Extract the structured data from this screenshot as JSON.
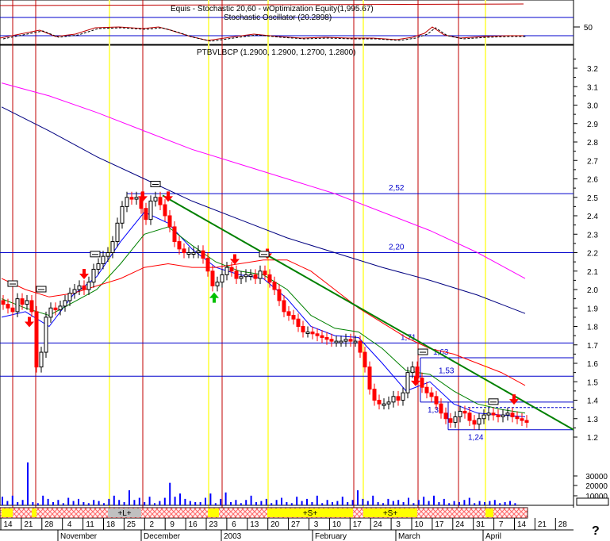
{
  "header": {
    "indicator_title": "Equis - Stochastic 20,60 - wOptimization Equity(1,995.67)",
    "oscillator_title": "Stochastic Oscillator (20.2898)",
    "oscillator_level_label": "50",
    "price_title": "PTBVLBCP (1.2900, 1.2900, 1.2700, 1.2800)",
    "help_glyph": "?"
  },
  "colors": {
    "up_candle": "#ffffff",
    "down_candle": "#ff0000",
    "ma_fast": "#0000ff",
    "ma_mid": "#008000",
    "ma_red": "#ff0000",
    "ma_magenta": "#ff00ff",
    "ma_navy": "#000080",
    "trendline": "#008000",
    "signal_up": "#00c000",
    "signal_down": "#ff0000",
    "vertical_red": "#c00000",
    "vertical_yellow": "#ffff66",
    "level_line": "#0000cc",
    "volume": "#0000ff"
  },
  "chart_data": {
    "type": "line",
    "title": "PTBVLBCP (1.2900, 1.2900, 1.2700, 1.2800)",
    "ylim": [
      1.15,
      3.3
    ],
    "y_ticks": [
      "3.2",
      "3.1",
      "3.0",
      "2.9",
      "2.8",
      "2.7",
      "2.6",
      "2.5",
      "2.4",
      "2.3",
      "2.2",
      "2.1",
      "2.0",
      "1.9",
      "1.8",
      "1.7",
      "1.6",
      "1.5",
      "1.4",
      "1.3",
      "1.2"
    ],
    "x_day_ticks": [
      "14",
      "21",
      "28",
      "4",
      "11",
      "18",
      "25",
      "2",
      "9",
      "16",
      "23",
      "6",
      "13",
      "20",
      "27",
      "3",
      "10",
      "17",
      "24",
      "3",
      "10",
      "17",
      "24",
      "31",
      "7",
      "14",
      "21",
      "28"
    ],
    "x_month_labels": [
      "November",
      "December",
      "2003",
      "February",
      "March",
      "April"
    ],
    "fib_levels": [
      {
        "label": "2,52",
        "value": 2.52
      },
      {
        "label": "2,20",
        "value": 2.2
      },
      {
        "label": "1,71",
        "value": 1.71
      },
      {
        "label": "1,63",
        "value": 1.63
      },
      {
        "label": "1,53",
        "value": 1.53
      },
      {
        "label": "1,39",
        "value": 1.39
      },
      {
        "label": "1,24",
        "value": 1.24
      }
    ],
    "series": [
      {
        "name": "PTBVLBCP close",
        "x": [
          0,
          6,
          12,
          18,
          24,
          30,
          36,
          42,
          48,
          54,
          60,
          66,
          72,
          78,
          84,
          90,
          96,
          102,
          108,
          114,
          120,
          126,
          132,
          138,
          144,
          150,
          156,
          162,
          168,
          174,
          180,
          186,
          192,
          198,
          204,
          210,
          216,
          222,
          228,
          234,
          240,
          246,
          252,
          258,
          264,
          270,
          276,
          282,
          288,
          294,
          300,
          306,
          312,
          318,
          324,
          330,
          336,
          342,
          348,
          354,
          360,
          366,
          372,
          378,
          384,
          390,
          396,
          402,
          408,
          414,
          420,
          426,
          432,
          438,
          444,
          450,
          456,
          462,
          468,
          474,
          480,
          486,
          492,
          498,
          504,
          510,
          516,
          522,
          528,
          534,
          540,
          546,
          552,
          558,
          564,
          570,
          576,
          582,
          588,
          594,
          600,
          606,
          612,
          618,
          624,
          630,
          636,
          642,
          648,
          654,
          660
        ],
        "values": [
          1.92,
          1.9,
          1.88,
          1.95,
          1.92,
          1.94,
          1.88,
          1.58,
          1.66,
          1.85,
          1.9,
          1.89,
          1.91,
          1.94,
          1.98,
          2.0,
          2.02,
          2.0,
          2.04,
          2.11,
          2.14,
          2.18,
          2.2,
          2.26,
          2.36,
          2.45,
          2.5,
          2.49,
          2.5,
          2.44,
          2.38,
          2.48,
          2.5,
          2.46,
          2.4,
          2.34,
          2.26,
          2.22,
          2.2,
          2.2,
          2.2,
          2.21,
          2.17,
          2.1,
          2.02,
          2.04,
          2.08,
          2.12,
          2.1,
          2.06,
          2.07,
          2.08,
          2.08,
          2.06,
          2.1,
          2.08,
          2.04,
          2.0,
          1.94,
          1.88,
          1.86,
          1.84,
          1.8,
          1.77,
          1.77,
          1.76,
          1.75,
          1.74,
          1.73,
          1.72,
          1.72,
          1.72,
          1.73,
          1.72,
          1.72,
          1.66,
          1.58,
          1.46,
          1.4,
          1.38,
          1.38,
          1.39,
          1.42,
          1.4,
          1.44,
          1.55,
          1.58,
          1.52,
          1.47,
          1.44,
          1.42,
          1.38,
          1.33,
          1.3,
          1.28,
          1.31,
          1.34,
          1.33,
          1.29,
          1.27,
          1.3,
          1.32,
          1.33,
          1.32,
          1.31,
          1.32,
          1.33,
          1.31,
          1.3,
          1.29,
          1.28
        ]
      },
      {
        "name": "Moving average (short)",
        "x": [
          0,
          30,
          60,
          90,
          120,
          150,
          180,
          210,
          240,
          270,
          300,
          330,
          360,
          390,
          420,
          450,
          480,
          510,
          540,
          570,
          600,
          630,
          660
        ],
        "values": [
          1.85,
          1.88,
          1.8,
          1.97,
          2.07,
          2.26,
          2.42,
          2.36,
          2.22,
          2.12,
          2.08,
          2.06,
          1.95,
          1.8,
          1.75,
          1.74,
          1.6,
          1.45,
          1.5,
          1.38,
          1.33,
          1.32,
          1.31
        ]
      },
      {
        "name": "Moving average (medium)",
        "x": [
          0,
          30,
          60,
          90,
          120,
          150,
          180,
          210,
          240,
          270,
          300,
          330,
          360,
          390,
          420,
          450,
          480,
          510,
          540,
          570,
          600,
          630,
          660
        ],
        "values": [
          1.95,
          1.9,
          1.86,
          1.93,
          2.0,
          2.14,
          2.3,
          2.34,
          2.24,
          2.15,
          2.1,
          2.08,
          2.0,
          1.86,
          1.79,
          1.77,
          1.68,
          1.56,
          1.54,
          1.45,
          1.38,
          1.35,
          1.33
        ]
      },
      {
        "name": "Moving average (long, red)",
        "x": [
          0,
          30,
          60,
          90,
          120,
          150,
          180,
          210,
          240,
          270,
          300,
          330,
          360,
          390,
          420,
          450,
          480,
          510,
          540,
          570,
          600,
          630,
          660
        ],
        "values": [
          2.06,
          2.0,
          1.96,
          1.98,
          2.02,
          2.06,
          2.12,
          2.14,
          2.12,
          2.12,
          2.14,
          2.16,
          2.16,
          2.1,
          2.0,
          1.9,
          1.82,
          1.74,
          1.68,
          1.65,
          1.6,
          1.55,
          1.48
        ]
      },
      {
        "name": "Moving average (magenta)",
        "x": [
          0,
          60,
          120,
          180,
          240,
          300,
          360,
          420,
          480,
          540,
          600,
          660
        ],
        "values": [
          3.12,
          3.05,
          2.96,
          2.86,
          2.76,
          2.68,
          2.6,
          2.52,
          2.42,
          2.32,
          2.2,
          2.06
        ]
      },
      {
        "name": "Moving average (navy)",
        "x": [
          0,
          60,
          120,
          180,
          240,
          300,
          360,
          420,
          480,
          540,
          600,
          660
        ],
        "values": [
          2.99,
          2.86,
          2.72,
          2.6,
          2.48,
          2.38,
          2.28,
          2.2,
          2.12,
          2.05,
          1.97,
          1.87
        ]
      }
    ],
    "volume": {
      "ticks": [
        "30000",
        "20000",
        "10000"
      ],
      "values": [
        8,
        4,
        9,
        3,
        5,
        40,
        3,
        2,
        9,
        6,
        3,
        5,
        2,
        7,
        4,
        6,
        3,
        2,
        5,
        4,
        2,
        6,
        9,
        5,
        3,
        14,
        5,
        7,
        3,
        8,
        2,
        4,
        7,
        21,
        8,
        11,
        6,
        4,
        3,
        3,
        7,
        11,
        2,
        6,
        12,
        3,
        5,
        2,
        5,
        9,
        3,
        4,
        6,
        2,
        5,
        7,
        3,
        2,
        8,
        4,
        6,
        3,
        9,
        2,
        5,
        3,
        4,
        8,
        3,
        5,
        14,
        6,
        4,
        9,
        3,
        2,
        6,
        4,
        5,
        3,
        7,
        2,
        5,
        8,
        4,
        9,
        3,
        6,
        2,
        4,
        3,
        5,
        7,
        2,
        4,
        3,
        4,
        5,
        2,
        3,
        4,
        2
      ]
    },
    "period_labels": [
      "+L+",
      "+S+",
      "+S+"
    ],
    "grid": false,
    "legend": "none"
  }
}
